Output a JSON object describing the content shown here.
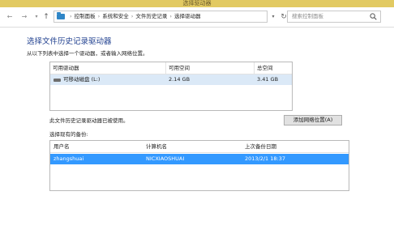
{
  "window": {
    "title": "选择驱动器"
  },
  "nav": {
    "breadcrumbs": [
      "控制面板",
      "系统和安全",
      "文件历史记录",
      "选择驱动器"
    ],
    "search_placeholder": "搜索控制面板"
  },
  "main": {
    "heading": "选择文件历史记录驱动器",
    "subtext": "从以下列表中选择一个驱动器，或者输入网络位置。",
    "drives": {
      "columns": [
        "可用驱动器",
        "可用空间",
        "总空间"
      ],
      "rows": [
        {
          "name": "可移动磁盘 (L:)",
          "free": "2.14 GB",
          "total": "3.41 GB"
        }
      ]
    },
    "in_use_text": "此文件历史记录驱动器已被使用。",
    "add_network_button": "添加网络位置(A)",
    "backups_label": "选择现有的备份:",
    "backups": {
      "columns": [
        "用户名",
        "计算机名",
        "上次备份日期"
      ],
      "rows": [
        {
          "user": "zhangshuai",
          "computer": "NICXIAOSHUAI",
          "date": "2013/2/1 18:37"
        }
      ]
    }
  },
  "colors": {
    "titlebar": "#e2ca62",
    "heading": "#1f3f8f",
    "selection": "#3399ff",
    "drive_row_highlight": "#dbe9f7"
  }
}
